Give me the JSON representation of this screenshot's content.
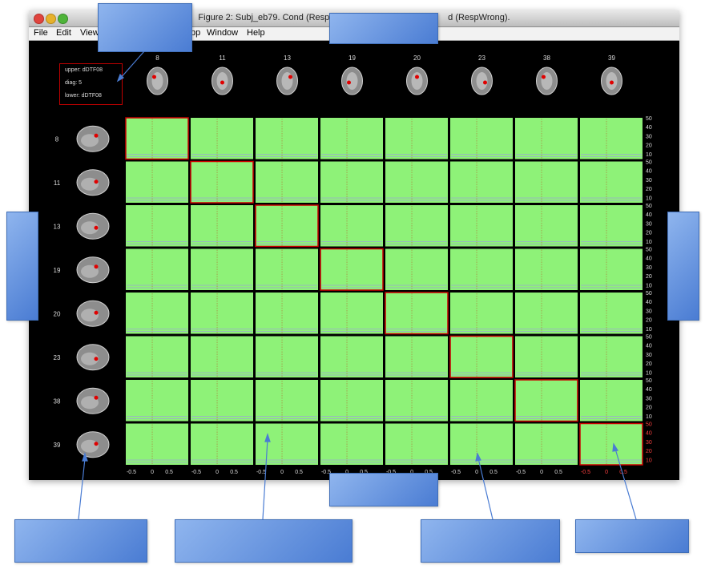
{
  "window": {
    "title": "Figure 2: Subj_eb79. Cond (RespWr",
    "title_suffix": "d (RespWrong).",
    "menus": [
      "File",
      "Edit",
      "View",
      "pp",
      "Window",
      "Help"
    ]
  },
  "legend": {
    "upper": "upper: dDTF08",
    "diag": "diag: 5",
    "lower": "lower: dDTF08"
  },
  "channels": [
    "8",
    "11",
    "13",
    "19",
    "20",
    "23",
    "38",
    "39"
  ],
  "axes": {
    "y_ticks": [
      "50",
      "40",
      "30",
      "20",
      "10"
    ],
    "x_ticks": [
      "-0.5",
      "0",
      "0.5"
    ],
    "grid_color": "#8ef278",
    "highlight_color": "#cc0000",
    "background": "#000000"
  },
  "callouts": [
    {
      "id": "menu-callout",
      "text": ""
    },
    {
      "id": "title-callout",
      "text": ""
    },
    {
      "id": "left-callout",
      "text": ""
    },
    {
      "id": "right-callout",
      "text": ""
    },
    {
      "id": "bottom-callout",
      "text": ""
    },
    {
      "id": "brain-callout",
      "text": ""
    },
    {
      "id": "cell-callout",
      "text": ""
    },
    {
      "id": "axis-callout",
      "text": ""
    },
    {
      "id": "corner-callout",
      "text": ""
    }
  ]
}
